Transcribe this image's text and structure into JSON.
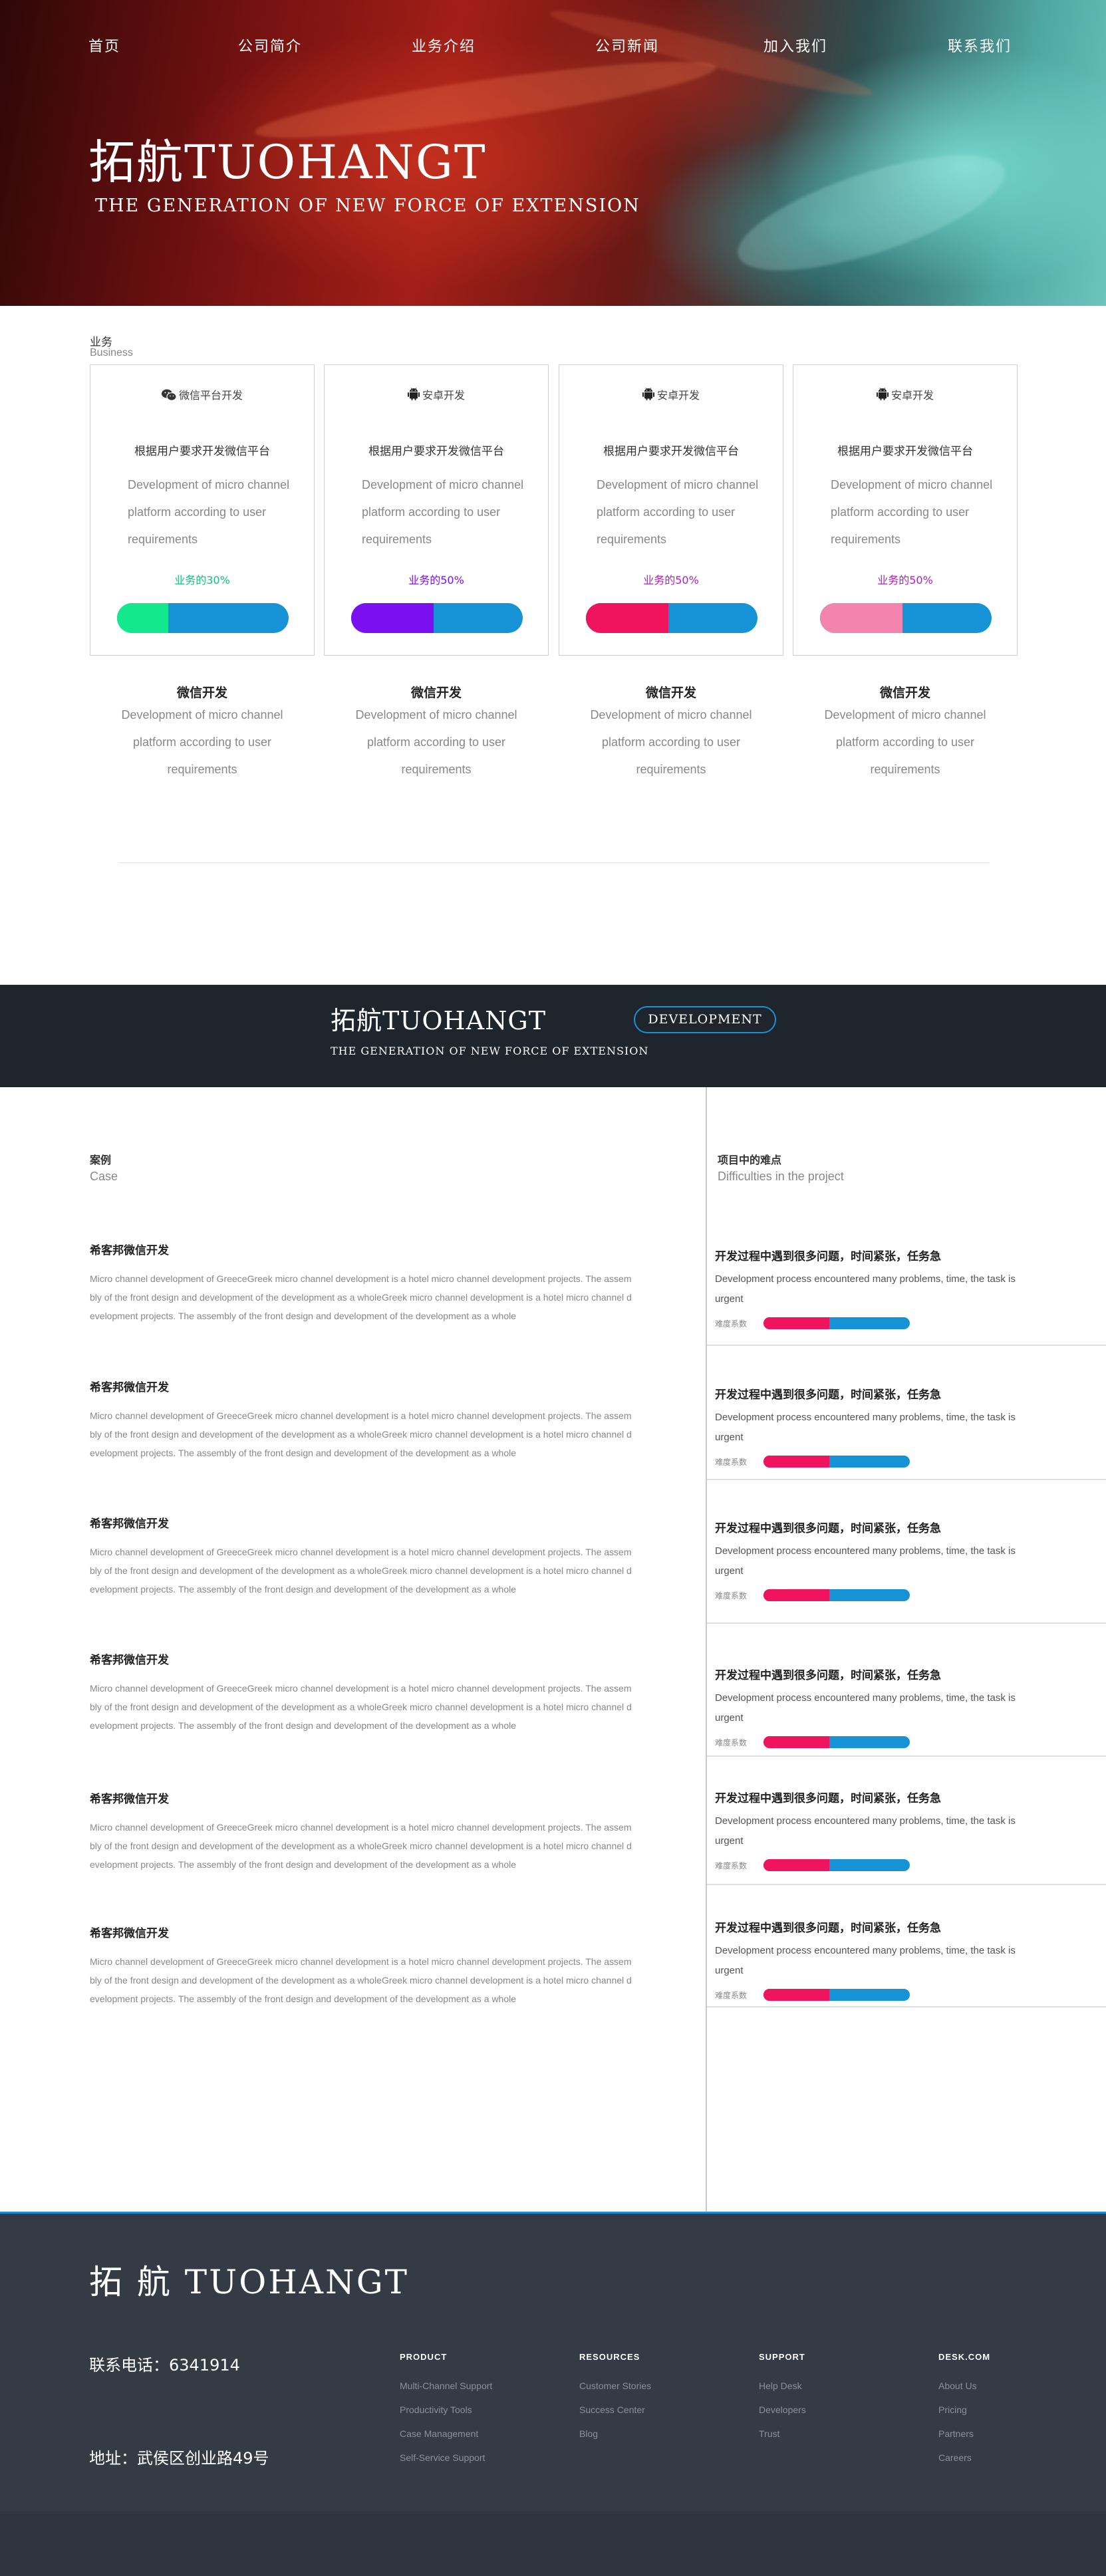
{
  "nav": [
    "首页",
    "公司简介",
    "业务介绍",
    "公司新闻",
    "加入我们",
    "联系我们"
  ],
  "hero": {
    "title": "拓航TUOHANGT",
    "subtitle": "THE GENERATION OF NEW FORCE OF EXTENSION"
  },
  "business": {
    "label": "业务",
    "label_en": "Business",
    "cards": [
      {
        "icon": "wechat-icon",
        "head": "微信平台开发",
        "zh": "根据用户要求开发微信平台",
        "en": "Development of micro channel platform according to user requirements",
        "pct_label": "业务的30%",
        "pct": 0.3,
        "color": "#14e88e",
        "label_color": "#14c07a"
      },
      {
        "icon": "android-icon",
        "head": "安卓开发",
        "zh": "根据用户要求开发微信平台",
        "en": "Development of micro channel platform according to user requirements",
        "pct_label": "业务的50%",
        "pct": 0.48,
        "color": "#7a10f0",
        "label_color": "#7a10f0"
      },
      {
        "icon": "android-icon",
        "head": "安卓开发",
        "zh": "根据用户要求开发微信平台",
        "en": "Development of micro channel platform according to user requirements",
        "pct_label": "业务的50%",
        "pct": 0.48,
        "color": "#f0145f",
        "label_color": "#b818c8"
      },
      {
        "icon": "android-icon",
        "head": "安卓开发",
        "zh": "根据用户要求开发微信平台",
        "en": "Development of micro channel platform according to user requirements",
        "pct_label": "业务的50%",
        "pct": 0.48,
        "color": "#f284ad",
        "label_color": "#b818c8"
      }
    ],
    "subs": [
      {
        "title": "微信开发",
        "text": "Development of micro channel platform according to user requirements"
      },
      {
        "title": "微信开发",
        "text": "Development of micro channel platform according to user requirements"
      },
      {
        "title": "微信开发",
        "text": "Development of micro channel platform according to user requirements"
      },
      {
        "title": "微信开发",
        "text": "Development of micro channel platform according to user requirements"
      }
    ]
  },
  "band": {
    "title": "拓航TUOHANGT",
    "subtitle": "THE GENERATION OF NEW FORCE OF EXTENSION",
    "button": "DEVELOPMENT"
  },
  "cases": {
    "label": "案例",
    "label_en": "Case",
    "items": [
      {
        "title": "希客邦微信开发",
        "text": "Micro channel development of GreeceGreek micro channel development is a hotel micro channel development projects. The assembly of the front design and development of the development as a wholeGreek micro channel development is a hotel micro channel development projects. The assembly of the front design and development of the development as a whole"
      },
      {
        "title": "希客邦微信开发",
        "text": "Micro channel development of GreeceGreek micro channel development is a hotel micro channel development projects. The assembly of the front design and development of the development as a wholeGreek micro channel development is a hotel micro channel development projects. The assembly of the front design and development of the development as a whole"
      },
      {
        "title": "希客邦微信开发",
        "text": "Micro channel development of GreeceGreek micro channel development is a hotel micro channel development projects. The assembly of the front design and development of the development as a wholeGreek micro channel development is a hotel micro channel development projects. The assembly of the front design and development of the development as a whole"
      },
      {
        "title": "希客邦微信开发",
        "text": "Micro channel development of GreeceGreek micro channel development is a hotel micro channel development projects. The assembly of the front design and development of the development as a wholeGreek micro channel development is a hotel micro channel development projects. The assembly of the front design and development of the development as a whole"
      },
      {
        "title": "希客邦微信开发",
        "text": "Micro channel development of GreeceGreek micro channel development is a hotel micro channel development projects. The assembly of the front design and development of the development as a wholeGreek micro channel development is a hotel micro channel development projects. The assembly of the front design and development of the development as a whole"
      },
      {
        "title": "希客邦微信开发",
        "text": "Micro channel development of GreeceGreek micro channel development is a hotel micro channel development projects. The assembly of the front design and development of the development as a wholeGreek micro channel development is a hotel micro channel development projects. The assembly of the front design and development of the development as a whole"
      }
    ]
  },
  "difficulties": {
    "label": "项目中的难点",
    "label_en": "Difficulties in the project",
    "items": [
      {
        "title": "开发过程中遇到很多问题，时间紧张，任务急",
        "text": "Development process encountered many problems, time, the task is urgent",
        "level_label": "难度系数",
        "level": 0.45
      },
      {
        "title": "开发过程中遇到很多问题，时间紧张，任务急",
        "text": "Development process encountered many problems, time, the task is urgent",
        "level_label": "难度系数",
        "level": 0.45
      },
      {
        "title": "开发过程中遇到很多问题，时间紧张，任务急",
        "text": "Development process encountered many problems, time, the task is urgent",
        "level_label": "难度系数",
        "level": 0.45
      },
      {
        "title": "开发过程中遇到很多问题，时间紧张，任务急",
        "text": "Development process encountered many problems, time, the task is urgent",
        "level_label": "难度系数",
        "level": 0.45
      },
      {
        "title": "开发过程中遇到很多问题，时间紧张，任务急",
        "text": "Development process encountered many problems, time, the task is urgent",
        "level_label": "难度系数",
        "level": 0.45
      },
      {
        "title": "开发过程中遇到很多问题，时间紧张，任务急",
        "text": "Development process encountered many problems, time, the task is urgent",
        "level_label": "难度系数",
        "level": 0.45
      }
    ]
  },
  "footer": {
    "logo": "拓 航 TUOHANGT",
    "phone": "联系电话：6341914",
    "address": "地址：武侯区创业路49号",
    "columns": [
      {
        "heading": "PRODUCT",
        "links": [
          "Multi-Channel Support",
          "Productivity Tools",
          "Case Management",
          "Self-Service Support"
        ]
      },
      {
        "heading": "RESOURCES",
        "links": [
          "Customer Stories",
          "Success Center",
          "Blog"
        ]
      },
      {
        "heading": "SUPPORT",
        "links": [
          "Help Desk",
          "Developers",
          "Trust"
        ]
      },
      {
        "heading": "DESK.COM",
        "links": [
          "About Us",
          "Pricing",
          "Partners",
          "Careers"
        ]
      }
    ]
  },
  "colors": {
    "accent": "#1593d6",
    "difficulty": "#f0145f",
    "band": "#1f252d",
    "footer": "#353b45"
  }
}
